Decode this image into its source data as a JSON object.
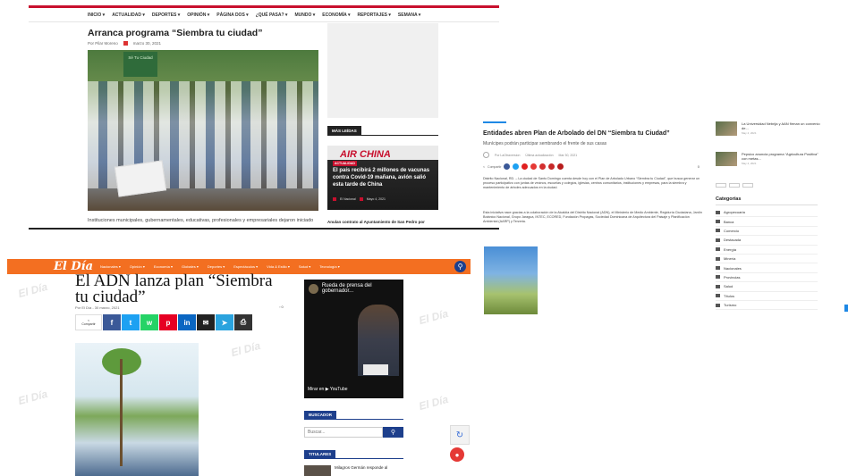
{
  "panel_a": {
    "nav": [
      "INICIO ▾",
      "ACTUALIDAD ▾",
      "DEPORTES ▾",
      "OPINIÓN ▾",
      "PÁGINA DOS ▾",
      "¿QUÉ PASA? ▾",
      "MUNDO ▾",
      "ECONOMÍA ▾",
      "REPORTAJES ▾",
      "SEMANA ▾"
    ],
    "title": "Arranca programa “Siembra tu ciudad”",
    "author": "Por Pilar Moreno",
    "date": "marzo 30, 2021",
    "sign_text": "Sé Tu Ciudad",
    "caption": "Instituciones municipales, gubernamentales, educativas, profesionales y empresariales dejaron iniciado",
    "mas_leidas": "MÁS LEÍDAS",
    "airchina_brand": "AIR CHINA",
    "airchina_tag": "ACTUALIDAD",
    "airchina_headline": "El país recibirá 2 millones de vacunas contra Covid-19 mañana, avión salió esta tarde de China",
    "airchina_author": "El Nacional",
    "airchina_date": "Mayo 4, 2021",
    "anulan": "Anulan contrato al Ayuntamiento de San Pedro por"
  },
  "panel_b": {
    "title": "Entidades abren Plan de Arbolado del DN “Siembra tu Ciudad”",
    "subtitle": "Munícipes podrán participar sembrando el frente de sus casas",
    "author": "Por LaOtraversion",
    "updated_label": "Última actualización",
    "updated_date": "Mar 30, 2021",
    "share_label": "Compartir",
    "share_count": "0",
    "body1": "Distrito Nacional, RD. – La ciudad de Santo Domingo cuenta desde hoy con el Plan de Arbolado Urbano “Siembra tu Ciudad”, que busca generar un proceso participativo con juntas de vecinos, escuelas y colegios, iglesias, centros comunitarios, instituciones y empresas, para la siembra y mantenimiento de árboles adecuados en la ciudad.",
    "body2": "Esta iniciativa nace gracias a la colaboración de la Alcaldía del Distrito Nacional (ADN), el Ministerio de Medio Ambiente, Regiduría Ciudadana, Jardín Botánico Nacional, Grupo Jaragua, INTEC, ECORED, Fundación Propagas, Sociedad Dominicana de Arquitectura del Paisaje y Planificación Ambiental (AARP) y Terzeria."
  },
  "panel_c": {
    "items": [
      {
        "text": "La Universidad Nebrija y AAN firman un convenio de...",
        "date": "May 4, 2021"
      },
      {
        "text": "Pepsico anuncia programa “Agricultura Positiva” con metas...",
        "date": "May 4, 2021"
      }
    ],
    "categories_title": "Categorías",
    "categories": [
      "Agropecuaria",
      "Banca",
      "Comercio",
      "Destacada",
      "Energía",
      "Minería",
      "Nacionales",
      "Provincias",
      "Salud",
      "Títulos",
      "Turismo"
    ]
  },
  "panel_d": {
    "logo": "El Día",
    "menu": [
      "Nacionales ▾",
      "Opinión ▾",
      "Economía ▾",
      "Globales ▾",
      "Deportes ▾",
      "Espectáculos ▾",
      "Vida & Estilo ▾",
      "Salud ▾",
      "Tecnología ▾"
    ],
    "title": "El ADN lanza plan “Siembra tu ciudad”",
    "meta": "Por El Día - 30 marzo, 2021",
    "comments": "0",
    "share_label": "Compartir",
    "video_title": "Rueda de prensa del gobernador...",
    "video_watch": "Mirar en ▶ YouTube",
    "buscador": "BUSCADOR",
    "search_placeholder": "Buscar...",
    "titulares": "TITULARES",
    "titular_item": "Milagros Germán responde al",
    "watermark": "El Día"
  },
  "colors": {
    "nacional_red": "#c8102e",
    "eldia_orange": "#f36f21",
    "eldia_blue": "#1d3f8c",
    "accent_blue": "#1e88e5"
  }
}
